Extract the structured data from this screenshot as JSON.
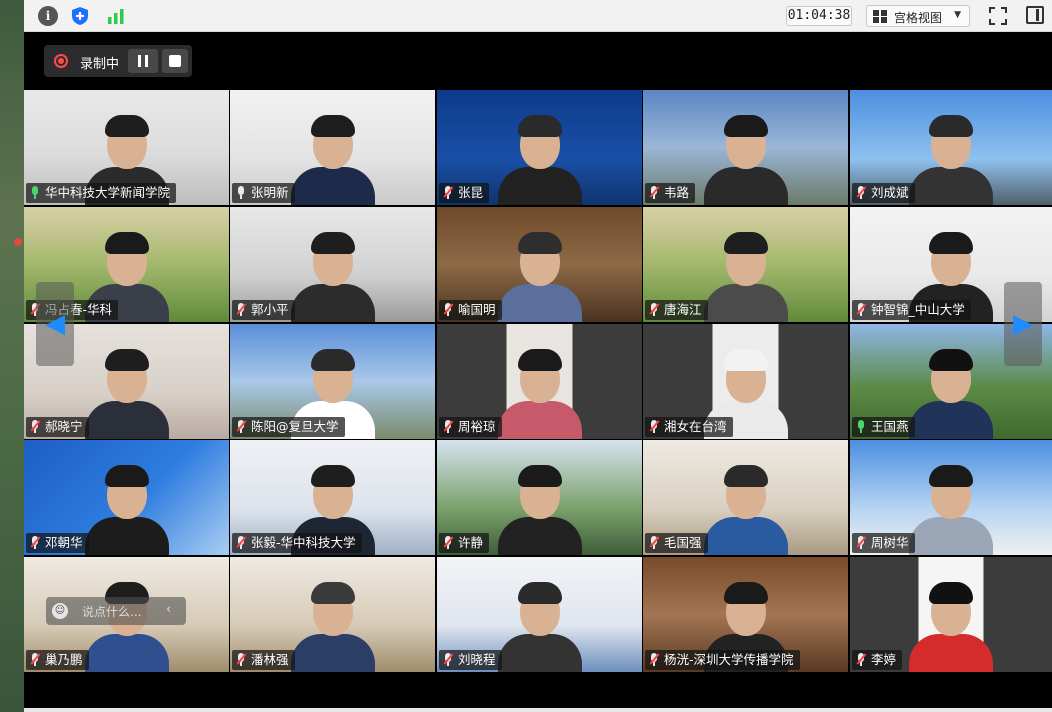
{
  "toolbar": {
    "timer": "01:04:38",
    "view_label": "宫格视图",
    "info_icon": "info-icon",
    "shield_icon": "shield-icon",
    "signal_icon": "signal-bars-icon",
    "fullscreen_icon": "fullscreen-icon",
    "panel_icon": "side-panel-icon"
  },
  "recording": {
    "label": "录制中",
    "status_color": "#ff4a4a"
  },
  "chat": {
    "placeholder": "说点什么...",
    "collapse": "‹"
  },
  "nav": {
    "prev": "◀",
    "next": "▶"
  },
  "accent_active_speaker": "#2fc94d",
  "participants": [
    {
      "name": "华中科技大学新闻学院",
      "mic": "on"
    },
    {
      "name": "张明新",
      "mic": "unmuted"
    },
    {
      "name": "张昆",
      "mic": "off"
    },
    {
      "name": "韦路",
      "mic": "off"
    },
    {
      "name": "刘成斌",
      "mic": "off"
    },
    {
      "name": "冯占春-华科",
      "mic": "off"
    },
    {
      "name": "郭小平",
      "mic": "off"
    },
    {
      "name": "喻国明",
      "mic": "off"
    },
    {
      "name": "唐海江",
      "mic": "off"
    },
    {
      "name": "钟智锦_中山大学",
      "mic": "off"
    },
    {
      "name": "郝晓宁",
      "mic": "off"
    },
    {
      "name": "陈阳@复旦大学",
      "mic": "off"
    },
    {
      "name": "周裕琼",
      "mic": "off"
    },
    {
      "name": "湘女在台湾",
      "mic": "off"
    },
    {
      "name": "王国燕",
      "mic": "on",
      "active": true
    },
    {
      "name": "邓朝华",
      "mic": "off"
    },
    {
      "name": "张毅-华中科技大学",
      "mic": "off"
    },
    {
      "name": "许静",
      "mic": "off"
    },
    {
      "name": "毛国强",
      "mic": "off"
    },
    {
      "name": "周树华",
      "mic": "off"
    },
    {
      "name": "巢乃鹏",
      "mic": "off"
    },
    {
      "name": "潘林强",
      "mic": "off"
    },
    {
      "name": "刘晓程",
      "mic": "off"
    },
    {
      "name": "杨洸-深圳大学传播学院",
      "mic": "off"
    },
    {
      "name": "李婷",
      "mic": "off"
    }
  ]
}
